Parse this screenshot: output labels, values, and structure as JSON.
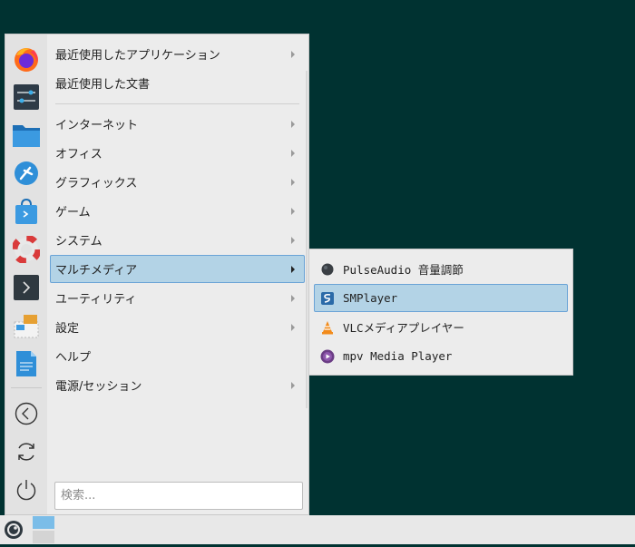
{
  "menu": {
    "categories": [
      {
        "label": "最近使用したアプリケーション",
        "submenu": true
      },
      {
        "label": "最近使用した文書",
        "submenu": false
      },
      {
        "label": "インターネット",
        "submenu": true
      },
      {
        "label": "オフィス",
        "submenu": true
      },
      {
        "label": "グラフィックス",
        "submenu": true
      },
      {
        "label": "ゲーム",
        "submenu": true
      },
      {
        "label": "システム",
        "submenu": true
      },
      {
        "label": "マルチメディア",
        "submenu": true,
        "active": true
      },
      {
        "label": "ユーティリティ",
        "submenu": true
      },
      {
        "label": "設定",
        "submenu": true
      },
      {
        "label": "ヘルプ",
        "submenu": false
      },
      {
        "label": "電源/セッション",
        "submenu": true
      }
    ],
    "search_placeholder": "検索..."
  },
  "favorites": [
    {
      "icon": "firefox-icon"
    },
    {
      "icon": "settings-sliders-icon"
    },
    {
      "icon": "file-manager-folder-icon"
    },
    {
      "icon": "software-center-icon"
    },
    {
      "icon": "shopping-bag-store-icon"
    },
    {
      "icon": "help-lifebuoy-icon"
    },
    {
      "icon": "terminal-icon"
    },
    {
      "icon": "package-installer-icon"
    },
    {
      "icon": "text-editor-icon"
    }
  ],
  "actions": [
    {
      "icon": "logout-back-icon"
    },
    {
      "icon": "restart-icon"
    },
    {
      "icon": "shutdown-icon"
    }
  ],
  "submenu": {
    "items": [
      {
        "label": "PulseAudio 音量調節",
        "icon": "pulseaudio-icon"
      },
      {
        "label": "SMPlayer",
        "icon": "smplayer-icon",
        "active": true
      },
      {
        "label": "VLCメディアプレイヤー",
        "icon": "vlc-cone-icon"
      },
      {
        "label": "mpv Media Player",
        "icon": "mpv-icon"
      }
    ]
  },
  "colors": {
    "desktop": "#003231",
    "highlight": "#b3d3e6",
    "highlight_border": "#6aa3d6"
  }
}
